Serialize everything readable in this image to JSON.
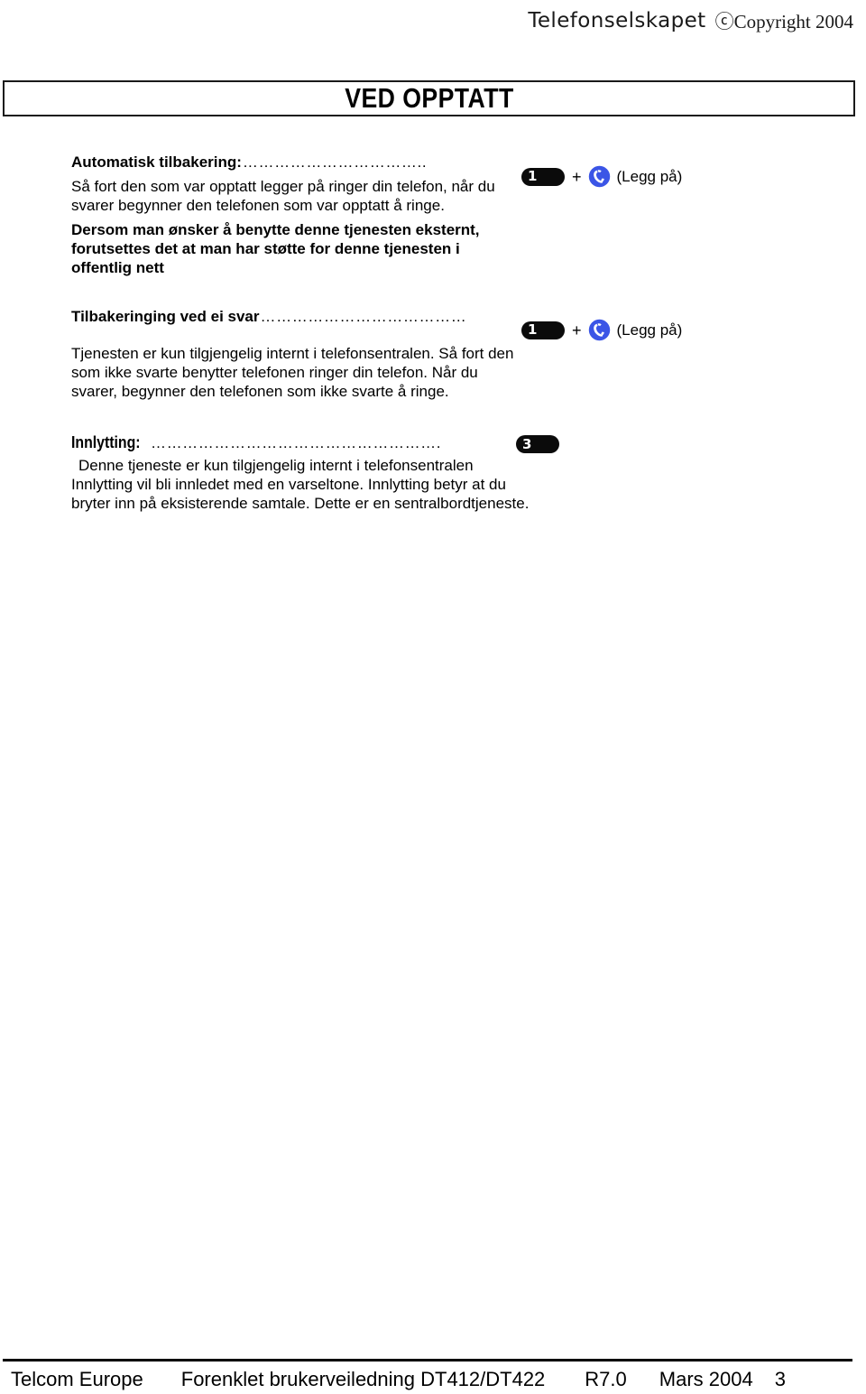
{
  "header": {
    "brand": "Telefonselskapet",
    "copyright": "ⓒCopyright 2004"
  },
  "title": {
    "text": "VED OPPTATT"
  },
  "sections": [
    {
      "heading": "Automatisk tilbakering:",
      "leader": "……………………………..",
      "body_1": "Så fort den som var opptatt legger på ringer din telefon, når du svarer begynner den telefonen som var opptatt å ringe.",
      "body_2": "Dersom man ønsker å benytte denne tjenesten eksternt, forutsettes det at man har støtte for denne tjenesten i offentlig nett",
      "keys": {
        "key_label": "1",
        "plus": "+",
        "icon": "phone-handset-icon",
        "caption": "(Legg på)"
      }
    },
    {
      "heading": "Tilbakeringing ved ei svar",
      "leader": "…………………………………",
      "body_1": "Tjenesten er kun tilgjengelig internt i telefonsentralen. Så fort den som ikke svarte benytter telefonen ringer din telefon. Når du svarer, begynner den telefonen som ikke svarte å ringe.",
      "keys": {
        "key_label": "1",
        "plus": "+",
        "icon": "phone-handset-icon",
        "caption": "(Legg på)"
      }
    },
    {
      "heading": "Innlytting:",
      "leader": "……………………………………………….",
      "body_1": "Denne tjeneste er kun tilgjengelig internt i telefonsentralen Innlytting vil bli innledet med en varseltone. Innlytting betyr at du bryter inn på eksisterende samtale. Dette er en sentralbordtjeneste.",
      "keys": {
        "key_label": "3"
      }
    }
  ],
  "footer": {
    "company": "Telcom Europe",
    "doc_title": "Forenklet brukerveiledning DT412/DT422",
    "release": "R7.0",
    "date": "Mars 2004",
    "page": "3"
  },
  "colors": {
    "icon_blue": "#3b55e6",
    "key_black": "#0b0b0b",
    "text": "#000000"
  }
}
